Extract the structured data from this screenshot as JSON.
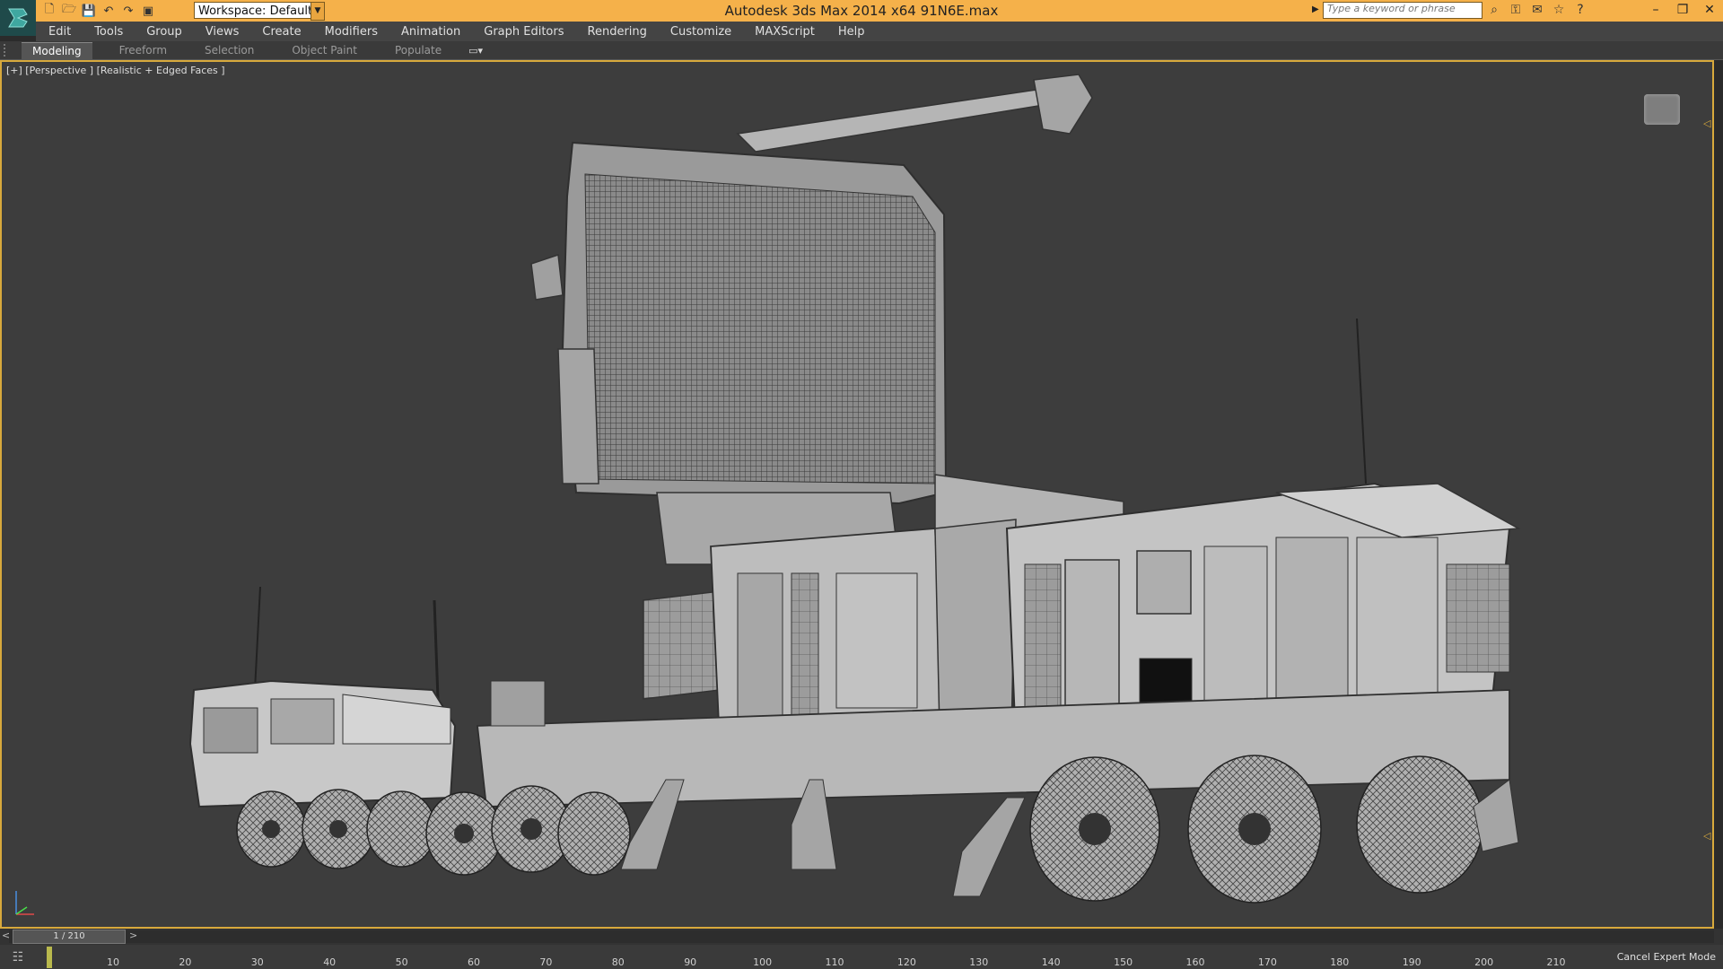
{
  "titlebar": {
    "title": "Autodesk 3ds Max  2014 x64      91N6E.max",
    "workspace_value": "Workspace: Default",
    "search_placeholder": "Type a keyword or phrase",
    "logo_icon": "3dsmax-logo-icon",
    "quick_access_icons": [
      "new-file-icon",
      "open-file-icon",
      "save-icon",
      "undo-icon",
      "redo-icon",
      "project-folder-icon"
    ],
    "help_icons": [
      "binoculars-icon",
      "key-icon",
      "communication-center-icon",
      "favorites-icon",
      "help-icon"
    ],
    "window_controls": {
      "minimize": "–",
      "restore": "❐",
      "close": "✕"
    }
  },
  "menubar": {
    "items": [
      "Edit",
      "Tools",
      "Group",
      "Views",
      "Create",
      "Modifiers",
      "Animation",
      "Graph Editors",
      "Rendering",
      "Customize",
      "MAXScript",
      "Help"
    ]
  },
  "ribbon": {
    "tabs": [
      "Modeling",
      "Freeform",
      "Selection",
      "Object Paint",
      "Populate"
    ],
    "active_tab": "Modeling"
  },
  "viewport": {
    "label": "[+] [Perspective ] [Realistic + Edged Faces ]"
  },
  "timeline": {
    "frame_readout": "1 / 210",
    "prev": "<",
    "next": ">",
    "ticks": [
      "10",
      "20",
      "30",
      "40",
      "50",
      "60",
      "70",
      "80",
      "90",
      "100",
      "110",
      "120",
      "130",
      "140",
      "150",
      "160",
      "170",
      "180",
      "190",
      "200",
      "210"
    ],
    "cancel_expert": "Cancel Expert Mode"
  },
  "colors": {
    "titlebar": "#f5b14a",
    "viewport_border": "#d8a93c",
    "viewport_bg": "#3d3d3d"
  }
}
